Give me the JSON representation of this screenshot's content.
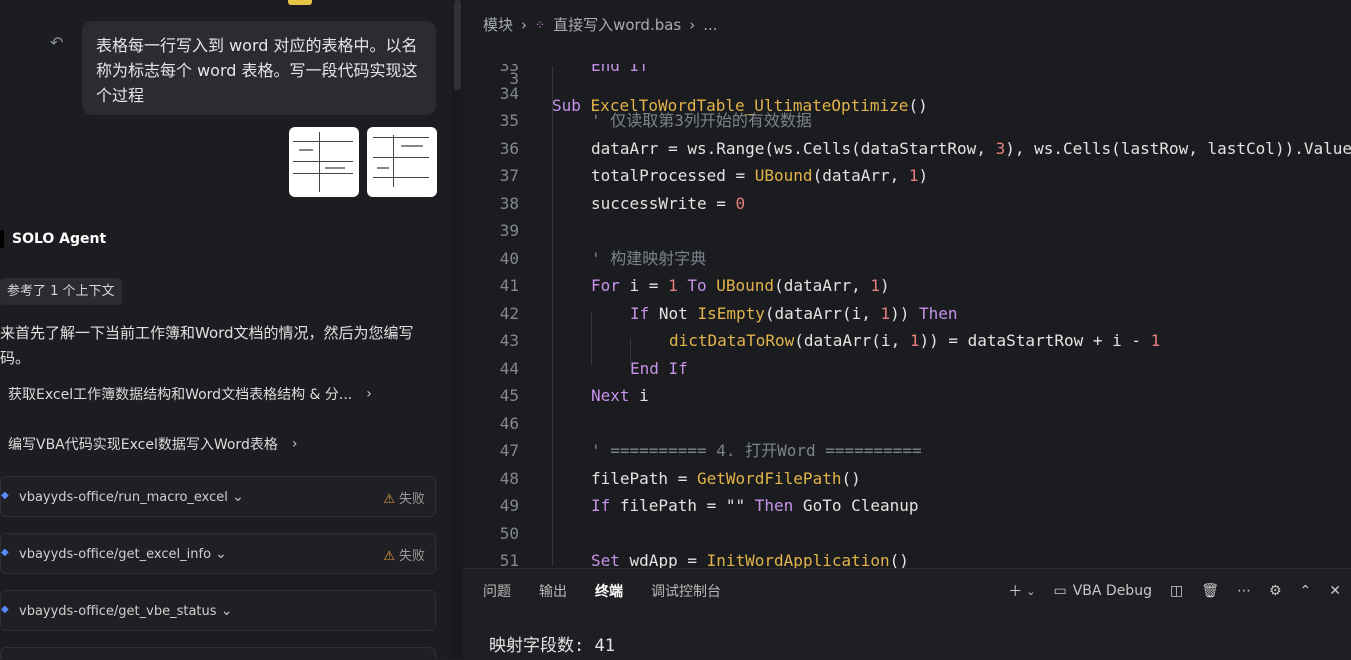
{
  "chat": {
    "user_message": "表格每一行写入到 word 对应的表格中。以名称为标志每个 word 表格。写一段代码实现这个过程",
    "agent_name": "SOLO Agent",
    "context_badge": "参考了 1 个上下文",
    "paragraph": "来首先了解一下当前工作簿和Word文档的情况，然后为您编写码。",
    "steps": [
      {
        "label": "获取Excel工作簿数据结构和Word文档表格结构 & 分..."
      },
      {
        "label": "编写VBA代码实现Excel数据写入Word表格"
      }
    ],
    "tools": [
      {
        "name": "vbayyds-office/run_macro_excel",
        "status": "失败"
      },
      {
        "name": "vbayyds-office/get_excel_info",
        "status": "失败"
      },
      {
        "name": "vbayyds-office/get_vbe_status",
        "status": ""
      }
    ]
  },
  "editor": {
    "breadcrumb": [
      "模块",
      "直接写入word.bas",
      "..."
    ],
    "sticky_line": {
      "num": "3",
      "text": "Sub ExcelToWordTable_UltimateOptimize()"
    },
    "lines": [
      {
        "num": "33",
        "text": "End If"
      },
      {
        "num": "34",
        "text": ""
      },
      {
        "num": "35",
        "text": "' 仅读取第3列开始的有效数据"
      },
      {
        "num": "36",
        "text": "dataArr = ws.Range(ws.Cells(dataStartRow, 3), ws.Cells(lastRow, lastCol)).Value"
      },
      {
        "num": "37",
        "text": "totalProcessed = UBound(dataArr, 1)"
      },
      {
        "num": "38",
        "text": "successWrite = 0"
      },
      {
        "num": "39",
        "text": ""
      },
      {
        "num": "40",
        "text": "' 构建映射字典"
      },
      {
        "num": "41",
        "text": "For i = 1 To UBound(dataArr, 1)"
      },
      {
        "num": "42",
        "text": "If Not IsEmpty(dataArr(i, 1)) Then"
      },
      {
        "num": "43",
        "text": "dictDataToRow(dataArr(i, 1)) = dataStartRow + i - 1"
      },
      {
        "num": "44",
        "text": "End If"
      },
      {
        "num": "45",
        "text": "Next i"
      },
      {
        "num": "46",
        "text": ""
      },
      {
        "num": "47",
        "text": "' ========== 4. 打开Word =========="
      },
      {
        "num": "48",
        "text": "filePath = GetWordFilePath()"
      },
      {
        "num": "49",
        "text": "If filePath = \"\" Then GoTo Cleanup"
      },
      {
        "num": "50",
        "text": ""
      },
      {
        "num": "51",
        "text": "Set wdApp = InitWordApplication()"
      }
    ]
  },
  "panel": {
    "tabs": [
      "问题",
      "输出",
      "终端",
      "调试控制台"
    ],
    "active_tab": "终端",
    "debug_label": "VBA Debug",
    "terminal_line": "映射字段数: 41"
  }
}
